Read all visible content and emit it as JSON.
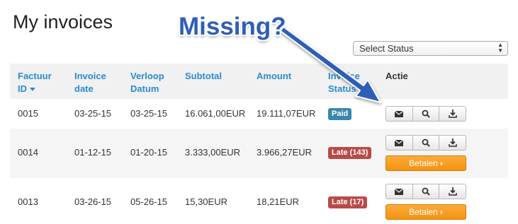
{
  "page": {
    "title": "My invoices"
  },
  "annotation": {
    "text": "Missing?"
  },
  "status_filter": {
    "selected": "Select Status"
  },
  "table": {
    "headers": [
      {
        "key": "id",
        "lines": [
          "Factuur",
          "ID"
        ],
        "sortable": true
      },
      {
        "key": "invoice_date",
        "lines": [
          "Invoice",
          "date"
        ]
      },
      {
        "key": "due_date",
        "lines": [
          "Verloop",
          "Datum"
        ]
      },
      {
        "key": "subtotal",
        "lines": [
          "Subtotal"
        ]
      },
      {
        "key": "amount",
        "lines": [
          "Amount"
        ]
      },
      {
        "key": "status",
        "lines": [
          "Invoice",
          "Status"
        ]
      },
      {
        "key": "action",
        "lines": [
          "Actie"
        ]
      }
    ],
    "rows": [
      {
        "id": "0015",
        "invoice_date": "03-25-15",
        "due_date": "03-25-15",
        "subtotal": "16.061,00EUR",
        "amount": "19.111,07EUR",
        "status": "Paid",
        "status_type": "paid",
        "pay_label": ""
      },
      {
        "id": "0014",
        "invoice_date": "01-12-15",
        "due_date": "01-20-15",
        "subtotal": "3.333,00EUR",
        "amount": "3.966,27EUR",
        "status": "Late (143)",
        "status_type": "late",
        "pay_label": "Betalen"
      },
      {
        "id": "0013",
        "invoice_date": "03-26-15",
        "due_date": "05-26-15",
        "subtotal": "15,30EUR",
        "amount": "18,21EUR",
        "status": "Late (17)",
        "status_type": "late",
        "pay_label": "Betalen"
      }
    ]
  },
  "actions": {
    "icons": [
      "envelope-icon",
      "search-icon",
      "download-icon"
    ]
  },
  "colors": {
    "link": "#2a8bd0",
    "paid": "#3a87ad",
    "late": "#b94a48",
    "pay_button": "#f49311",
    "annotation": "#2f5fb7"
  }
}
